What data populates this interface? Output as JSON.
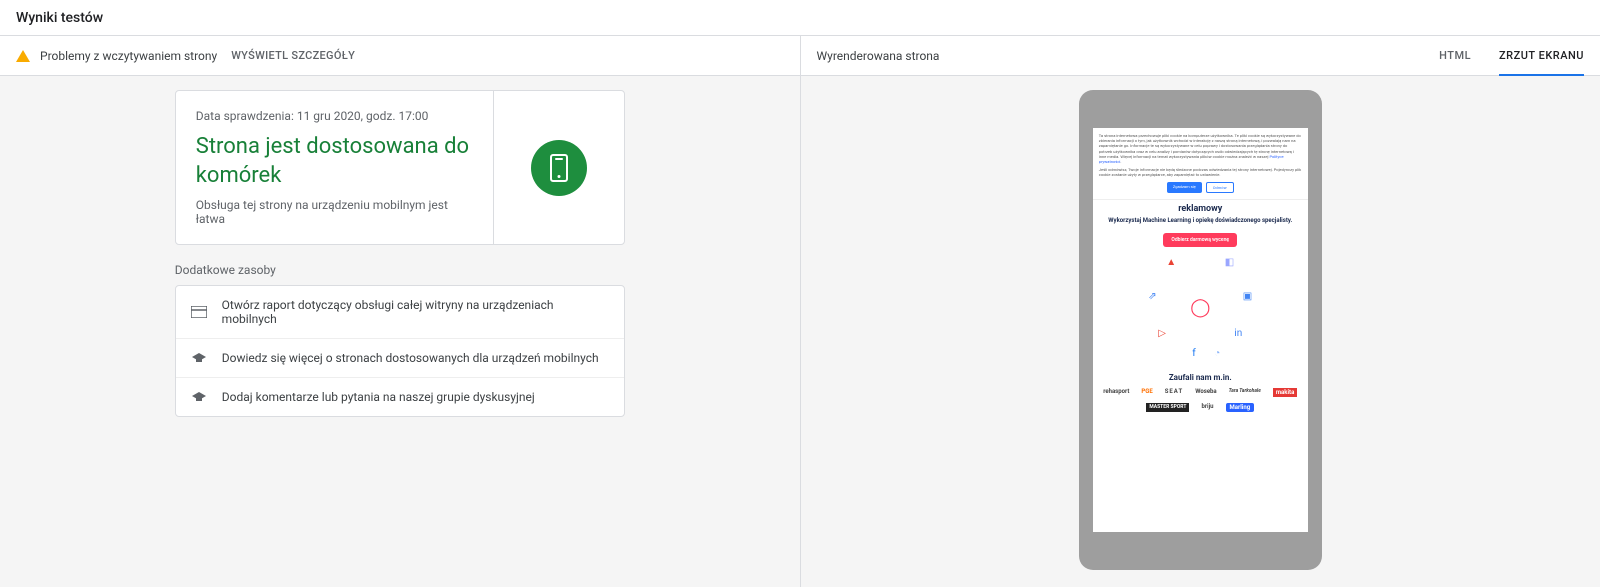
{
  "header": {
    "title": "Wyniki testów"
  },
  "left": {
    "warning": "Problemy z wczytywaniem strony",
    "details_link": "WYŚWIETL SZCZEGÓŁY",
    "card": {
      "date": "Data sprawdzenia: 11 gru 2020, godz. 17:00",
      "title": "Strona jest dostosowana do komórek",
      "subtitle": "Obsługa tej strony na urządzeniu mobilnym jest łatwa"
    },
    "resources_title": "Dodatkowe zasoby",
    "resources": [
      "Otwórz raport dotyczący obsługi całej witryny na urządzeniach mobilnych",
      "Dowiedz się więcej o stronach dostosowanych dla urządzeń mobilnych",
      "Dodaj komentarze lub pytania na naszej grupie dyskusyjnej"
    ]
  },
  "right": {
    "label": "Wyrenderowana strona",
    "tabs": {
      "html": "HTML",
      "screenshot": "ZRZUT EKRANU"
    }
  },
  "preview": {
    "cookie_text": "Ta strona internetowa przechowuje pliki cookie na komputerze użytkownika. Te pliki cookie są wykorzystywane do zbierania informacji o tym, jak użytkownik wchodzi w interakcję z naszą stroną internetową, i pozwalają nam na zapamiętanie go. Informacje te są wykorzystywane w celu poprawy i dostosowania przeglądania strony do potrzeb użytkownika oraz w celu analizy i pomiarów dotyczących osób odwiedzających tę stronę internetową i inne media. Więcej informacji na temat wykorzystywania plików cookie można znaleźć w naszej",
    "cookie_link": "Polityce prywatności",
    "cookie_text2": "Jeśli odmówisz, Twoje informacje nie będą śledzone podczas odwiedzania tej strony internetowej. Pojedynczy plik cookie zostanie użyty w przeglądarce, aby zapamiętać to ustawienie.",
    "accept": "Zgadzam się",
    "deny": "Odmów",
    "hero_title_cut": "reklamowy",
    "hero_sub": "Wykorzystaj Machine Learning i opiekę doświadczonego specjalisty.",
    "hero_btn": "Odbierz darmową wycenę",
    "trust_title": "Zaufali nam m.in.",
    "logos": [
      "rehasport",
      "PGE",
      "SEAT",
      "Woseba",
      "Tara Tarkohale",
      "makita",
      "MASTER SPORT",
      "briju",
      "Marling"
    ]
  }
}
